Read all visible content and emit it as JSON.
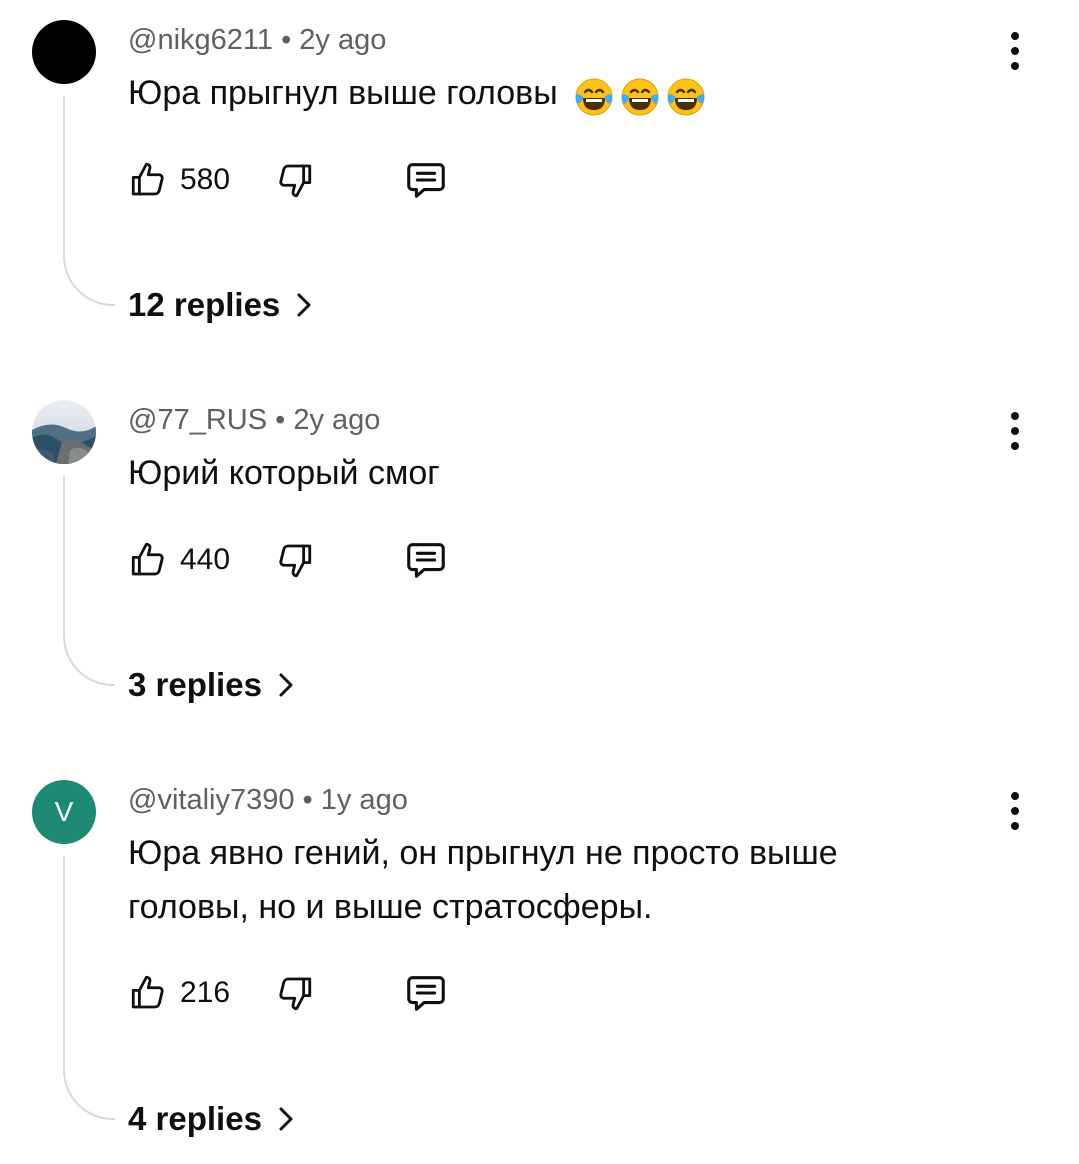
{
  "comments": [
    {
      "author": "@nikg6211",
      "time": "2y ago",
      "text": "Юра прыгнул выше головы",
      "emojis": [
        "face-with-tears-of-joy-icon",
        "face-with-tears-of-joy-icon",
        "face-with-tears-of-joy-icon"
      ],
      "likes": "580",
      "replies_label": "12 replies",
      "avatar": {
        "kind": "dark",
        "color": "#000000"
      }
    },
    {
      "author": "@77_RUS",
      "time": "2y ago",
      "text": "Юрий который смог",
      "likes": "440",
      "replies_label": "3 replies",
      "avatar": {
        "kind": "photo"
      }
    },
    {
      "author": "@vitaliy7390",
      "time": "1y ago",
      "text": "Юра явно гений, он прыгнул не просто выше головы, но и выше стратосферы.",
      "likes": "216",
      "replies_label": "4 replies",
      "avatar": {
        "kind": "letter",
        "letter": "V",
        "color": "#1e8a73"
      }
    }
  ],
  "separator": "•",
  "icons": {
    "like": "thumbs-up-icon",
    "dislike": "thumbs-down-icon",
    "reply": "comment-icon",
    "more": "more-vert-icon",
    "chevron": "chevron-right-icon"
  }
}
